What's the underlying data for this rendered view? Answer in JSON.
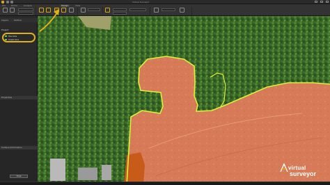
{
  "app": {
    "title": "Virtual Surveyor"
  },
  "ribbon": {
    "tabs": [
      "File",
      "Home",
      "Analyze",
      "Design",
      "View"
    ],
    "active_tab_index": 3,
    "groups": [
      {
        "label": "Terrain"
      },
      {
        "label": "Edit"
      },
      {
        "label": "Lines"
      },
      {
        "label": "Tools"
      },
      {
        "label": "Points"
      }
    ]
  },
  "panel": {
    "tabs": [
      "Layers",
      "Outline"
    ],
    "project_label": "Project",
    "items": [
      {
        "label": "Toe Line",
        "color": "#6fc34a"
      },
      {
        "label": "Crest Line",
        "color": "#6fc34a"
      }
    ],
    "properties_header": "Properties",
    "properties_text": "",
    "status_header": "Surface Information",
    "status_text": "",
    "action_button": "Close"
  },
  "logo": {
    "line1": "virtual",
    "line2": "surveyor"
  },
  "colors": {
    "accent": "#e0b21a",
    "line_highlight": "#d9f23a",
    "vegetation": "#3d6e2a",
    "soil": "#d8754f"
  }
}
